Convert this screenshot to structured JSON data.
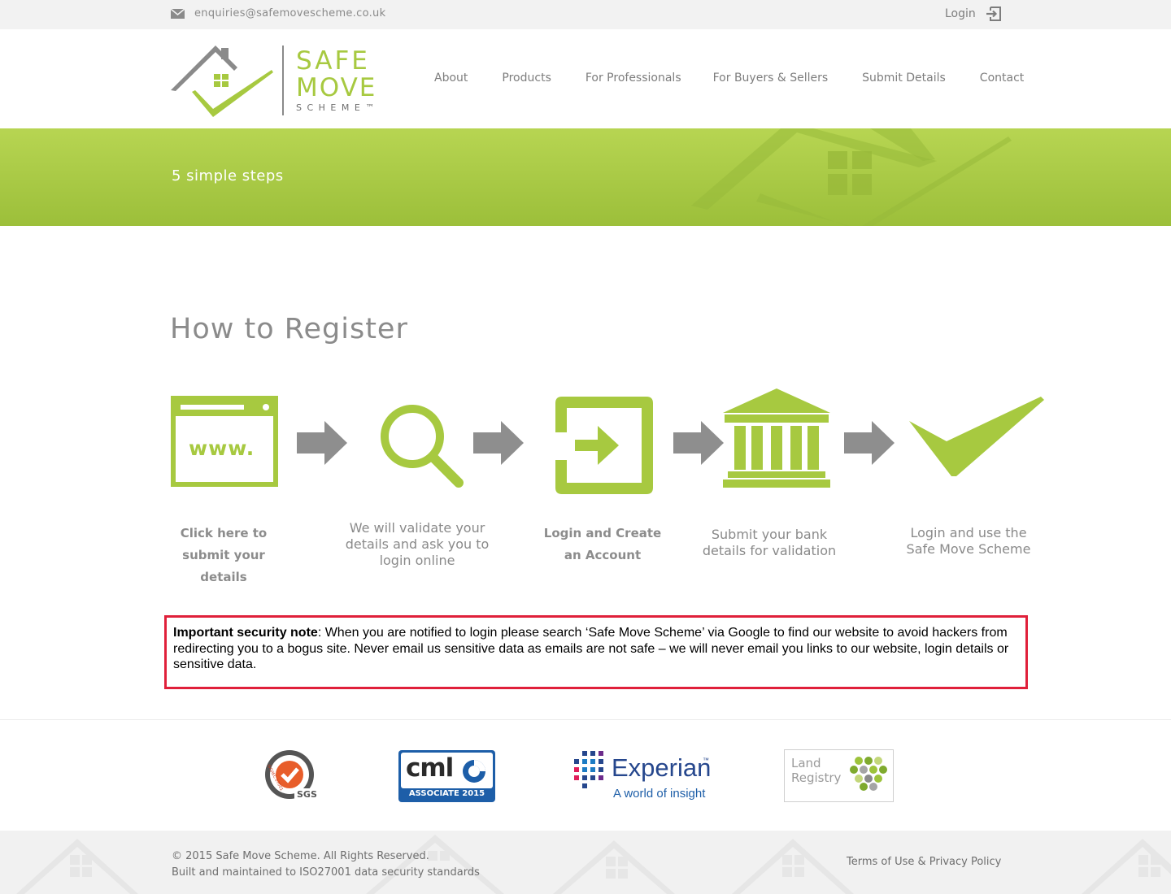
{
  "topbar": {
    "email": "enquiries@safemovescheme.co.uk",
    "login_label": "Login"
  },
  "logo": {
    "line1": "SAFE",
    "line2": "MOVE",
    "line3": "SCHEME™"
  },
  "nav": {
    "items": [
      {
        "label": "About"
      },
      {
        "label": "Products"
      },
      {
        "label": "For Professionals"
      },
      {
        "label": "For Buyers & Sellers"
      },
      {
        "label": "Submit Details"
      },
      {
        "label": "Contact"
      }
    ]
  },
  "banner": {
    "title": "5 simple steps"
  },
  "main": {
    "title": "How to Register",
    "steps": [
      {
        "icon": "www-browser-icon",
        "line1": "Click here to",
        "line2": "submit your details"
      },
      {
        "icon": "magnifier-icon",
        "line1": "We will validate your",
        "line2": "details and ask you to",
        "line3": "login online"
      },
      {
        "icon": "login-arrow-icon",
        "line1": "Login and Create",
        "line2": "an Account"
      },
      {
        "icon": "bank-icon",
        "line1": "Submit your bank",
        "line2": "details for validation"
      },
      {
        "icon": "checkmark-icon",
        "line1": "Login and use the",
        "line2": "Safe Move Scheme"
      }
    ],
    "www_text": "www."
  },
  "security_note": {
    "heading": "Important security note",
    "text": ": When you are notified to login please search ‘Safe Move Scheme’ via Google to find our website to avoid hackers from redirecting you to a bogus site. Never email us sensitive data as emails are not safe – we will never email you links to our website, login details or sensitive data."
  },
  "partners": {
    "sgs": {
      "text": "SGS",
      "ring_text": "ISO/IEC 27001"
    },
    "cml": {
      "text": "cml",
      "subtext": "ASSOCIATE 2015"
    },
    "experian": {
      "text": "Experian",
      "tm": "™",
      "tagline": "A world of insight"
    },
    "land_registry": {
      "line1": "Land",
      "line2": "Registry"
    }
  },
  "footer": {
    "copyright": "© 2015 Safe Move Scheme. All Rights Reserved.",
    "standards": "Built and maintained to ISO27001 data security standards",
    "terms": "Terms of Use",
    "amp": " & ",
    "privacy": "Privacy Policy"
  },
  "colors": {
    "brand_green": "#a7c940",
    "arrow_gray": "#8e8e8e",
    "note_border": "#e0203a"
  }
}
